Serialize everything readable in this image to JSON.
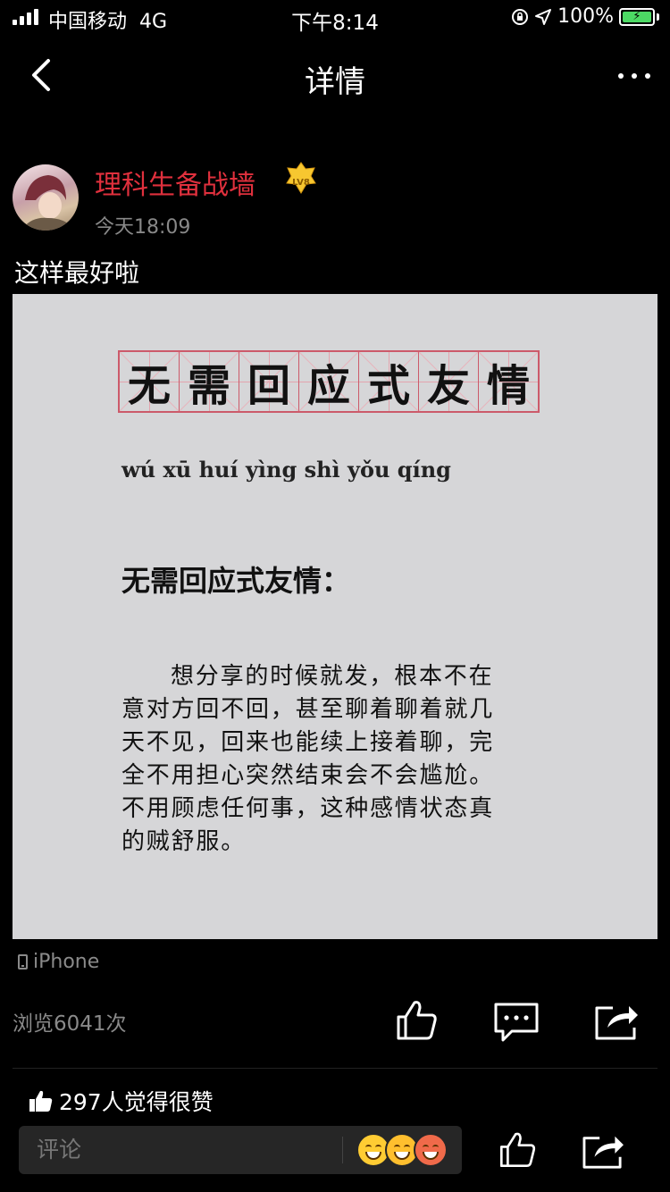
{
  "status_bar": {
    "carrier": "中国移动",
    "network": "4G",
    "time": "下午8:14",
    "battery": "100%"
  },
  "nav": {
    "title": "详情"
  },
  "post": {
    "author": "理科生备战墙",
    "level": "LV8",
    "time": "今天18:09",
    "text": "这样最好啦",
    "image": {
      "grid_chars": [
        "无",
        "需",
        "回",
        "应",
        "式",
        "友",
        "情"
      ],
      "pinyin": "wú xū huí yìng shì yǒu qíng",
      "heading": "无需回应式友情：",
      "body_lines": [
        "想分享的时候就发，根本不在",
        "意对方回不回，甚至聊着聊着就几",
        "天不见，回来也能续上接着聊，完",
        "全不用担心突然结束会不会尴尬。",
        "不用顾虑任何事，这种感情状态真",
        "的贼舒服。"
      ]
    },
    "device": "iPhone",
    "views": "浏览6041次",
    "likes_text": "297人觉得很赞"
  },
  "bottom_bar": {
    "comment_placeholder": "评论"
  },
  "colors": {
    "author": "#e0303d",
    "grid_line": "#cc5a6a",
    "battery": "#4cd964"
  },
  "icons": [
    "back-icon",
    "more-icon",
    "thumbs-up-icon",
    "comment-icon",
    "share-icon",
    "phone-icon",
    "emoji-icon"
  ]
}
